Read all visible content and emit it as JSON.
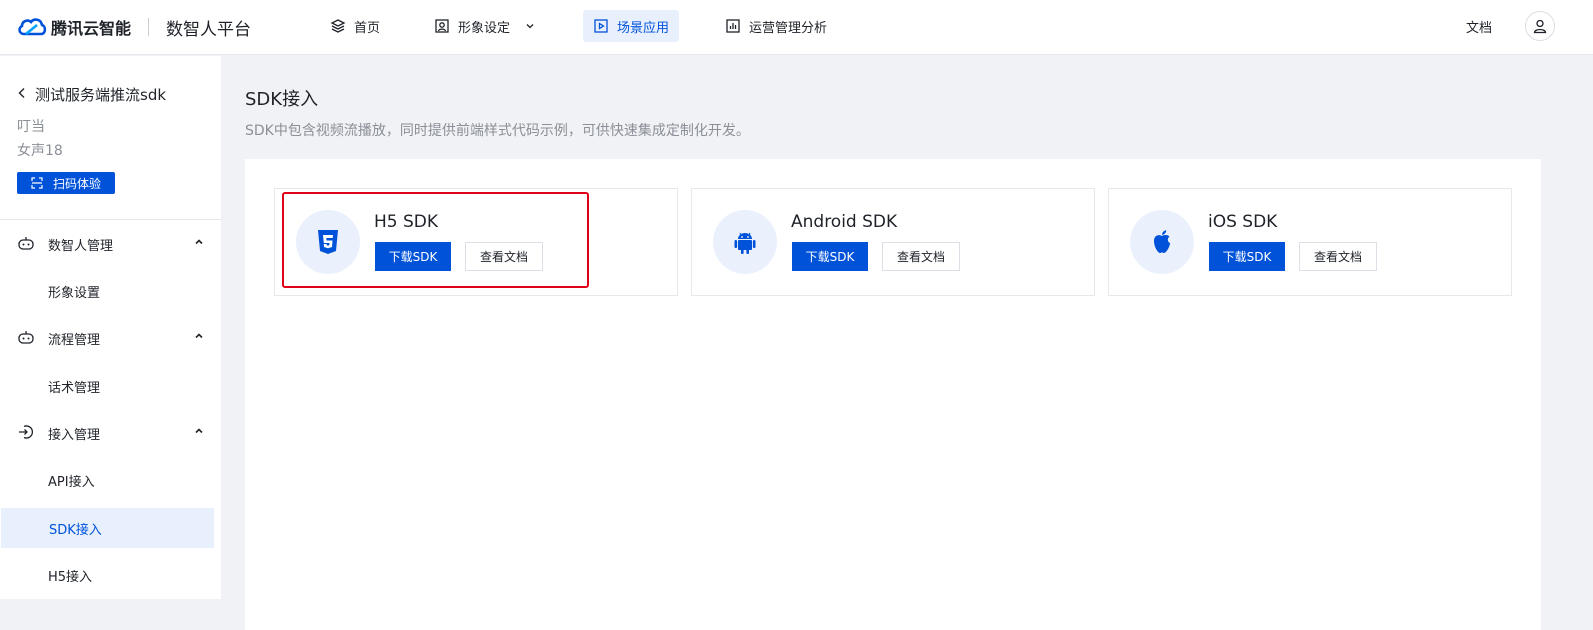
{
  "header": {
    "brand": "腾讯云智能",
    "product": "数智人平台",
    "nav": [
      {
        "label": "首页",
        "icon": "layers-icon"
      },
      {
        "label": "形象设定",
        "icon": "portrait-icon"
      },
      {
        "label": "场景应用",
        "icon": "play-square-icon"
      },
      {
        "label": "运营管理分析",
        "icon": "bar-chart-icon"
      }
    ],
    "doc_label": "文档"
  },
  "sidebar": {
    "back_title": "测试服务端推流sdk",
    "sub1": "叮当",
    "sub2": "女声18",
    "scan_label": "扫码体验",
    "groups": [
      {
        "label": "数智人管理",
        "icon": "robot-icon",
        "items": [
          "形象设置"
        ]
      },
      {
        "label": "流程管理",
        "icon": "robot-icon",
        "items": [
          "话术管理"
        ]
      },
      {
        "label": "接入管理",
        "icon": "login-icon",
        "items": [
          "API接入",
          "SDK接入",
          "H5接入"
        ]
      }
    ]
  },
  "main": {
    "title": "SDK接入",
    "description": "SDK中包含视频流播放，同时提供前端样式代码示例，可供快速集成定制化开发。",
    "cards": [
      {
        "name": "H5 SDK",
        "icon": "html5-icon",
        "download": "下载SDK",
        "docs": "查看文档"
      },
      {
        "name": "Android SDK",
        "icon": "android-icon",
        "download": "下载SDK",
        "docs": "查看文档"
      },
      {
        "name": "iOS SDK",
        "icon": "apple-icon",
        "download": "下载SDK",
        "docs": "查看文档"
      }
    ]
  },
  "colors": {
    "primary": "#0052d9",
    "highlight": "#e0001a",
    "icon_bg": "#eaf1fd"
  }
}
